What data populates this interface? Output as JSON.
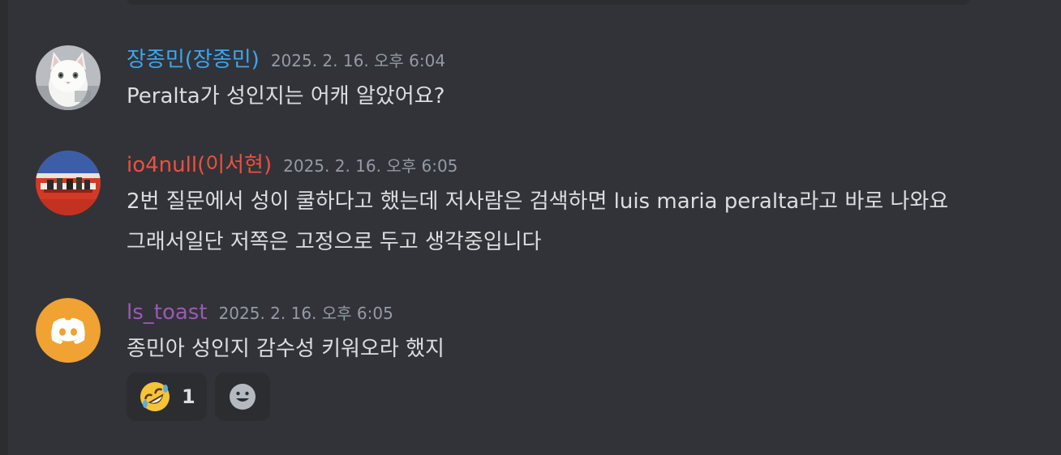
{
  "colors": {
    "background": "#313338",
    "username_1": "#3ea6ef",
    "username_2": "#ef4f3f",
    "username_3": "#9b59b6",
    "timestamp": "#949ba4"
  },
  "messages": [
    {
      "username": "장종민(장종민)",
      "timestamp": "2025. 2. 16. 오후 6:04",
      "lines": [
        "Peralta가 성인지는 어캐 알았어요?"
      ],
      "avatar_icon": "white-cat-avatar-icon"
    },
    {
      "username": "io4null(이서현)",
      "timestamp": "2025. 2. 16. 오후 6:05",
      "lines": [
        "2번 질문에서 성이 쿨하다고 했는데 저사람은 검색하면 luis maria peralta라고 바로 나와요",
        "그래서일단 저쪽은 고정으로 두고 생각중입니다"
      ],
      "avatar_icon": "album-art-avatar-icon"
    },
    {
      "username": "ls_toast",
      "timestamp": "2025. 2. 16. 오후 6:05",
      "lines": [
        "종민아 성인지 감수성 키워오라 했지"
      ],
      "avatar_icon": "discord-default-avatar-icon",
      "reactions": [
        {
          "emoji": "rolling-on-floor-laughing-icon",
          "count": "1"
        }
      ],
      "add_reaction_icon": "smiley-add-reaction-icon"
    }
  ]
}
